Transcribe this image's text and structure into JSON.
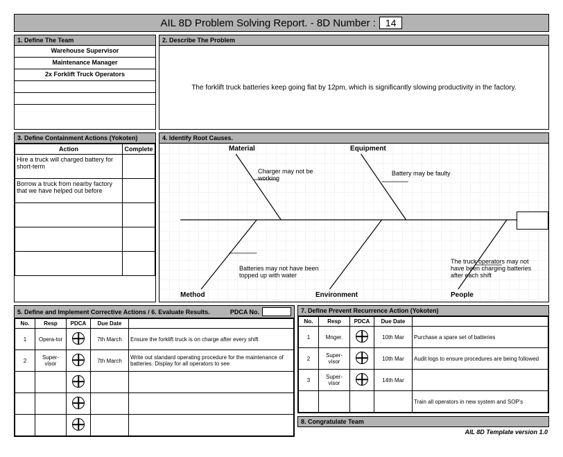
{
  "title": {
    "text": "AIL 8D Problem Solving Report. - 8D Number :",
    "number": "14"
  },
  "s1": {
    "header": "1. Define The Team",
    "members": [
      "Warehouse Supervisor",
      "Maintenance Manager",
      "2x Forklift Truck Operators",
      "",
      "",
      ""
    ]
  },
  "s2": {
    "header": "2. Describe The Problem",
    "body": "The forklift truck batteries keep going flat by 12pm, which is significantly slowing productivity in the factory."
  },
  "s3": {
    "header": "3. Define Containment Actions (Yokoten)",
    "col_action": "Action",
    "col_complete": "Complete",
    "rows": [
      {
        "action": "Hire a truck will charged battery for short-term",
        "complete": ""
      },
      {
        "action": "Borrow a truck from nearby factory that we have helped out before",
        "complete": ""
      },
      {
        "action": "",
        "complete": ""
      },
      {
        "action": "",
        "complete": ""
      },
      {
        "action": "",
        "complete": ""
      }
    ]
  },
  "s4": {
    "header": "4. Identify Root Causes.",
    "cat": {
      "material": "Material",
      "equipment": "Equipment",
      "method": "Method",
      "environment": "Environment",
      "people": "People"
    },
    "notes": {
      "n1": "Charger may not be working",
      "n2": "Battery may be faulty",
      "n3": "Batteries may not have been topped up with water",
      "n4": "The truck operators may not have been charging batteries after each shift"
    }
  },
  "s5": {
    "header": "5. Define and Implement Corrective Actions /  6. Evaluate Results.",
    "pdca_label": "PDCA No.",
    "cols": {
      "no": "No.",
      "resp": "Resp",
      "pdca": "PDCA",
      "due": "Due Date"
    },
    "rows": [
      {
        "no": "1",
        "resp": "Opera-tor",
        "due": "7th March",
        "desc": "Ensure the forklift truck is on charge after every shift"
      },
      {
        "no": "2",
        "resp": "Super-visor",
        "due": "7th March",
        "desc": "Write out standard operating procedure for the maintenance of batteries.  Display for all operators to see"
      },
      {
        "no": "",
        "resp": "",
        "due": "",
        "desc": ""
      },
      {
        "no": "",
        "resp": "",
        "due": "",
        "desc": ""
      },
      {
        "no": "",
        "resp": "",
        "due": "",
        "desc": ""
      }
    ]
  },
  "s7": {
    "header": "7. Define Prevent Recurrence Action (Yokoten)",
    "cols": {
      "no": "No.",
      "resp": "Resp",
      "pdca": "PDCA",
      "due": "Due Date"
    },
    "rows": [
      {
        "no": "1",
        "resp": "Mnger.",
        "due": "10th Mar",
        "desc": "Purchase a spare set of batteries"
      },
      {
        "no": "2",
        "resp": "Super-visor",
        "due": "10th Mar",
        "desc": "Audit logs to ensure procedures are being followed"
      },
      {
        "no": "3",
        "resp": "Super-visor",
        "due": "14th Mar",
        "desc": ""
      },
      {
        "no": "",
        "resp": "",
        "due": "",
        "desc": "Train all operators in new system and SOP's"
      }
    ]
  },
  "s8": {
    "header": "8. Congratulate Team"
  },
  "footer": {
    "version": "AIL 8D Template version 1.0"
  }
}
